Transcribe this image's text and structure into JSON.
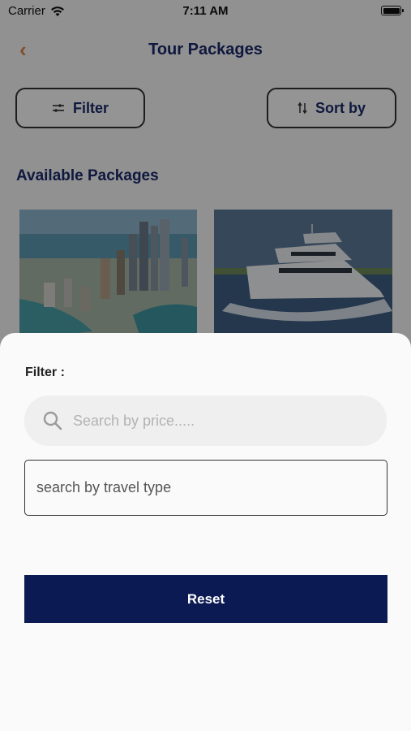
{
  "status": {
    "carrier": "Carrier",
    "time": "7:11 AM"
  },
  "nav": {
    "back_glyph": "‹",
    "title": "Tour Packages"
  },
  "toolbar": {
    "filter_label": "Filter",
    "sort_label": "Sort by"
  },
  "section": {
    "title": "Available Packages"
  },
  "packages": [
    {
      "image": "city-skyline-image"
    },
    {
      "image": "yacht-image"
    }
  ],
  "filter_sheet": {
    "label": "Filter :",
    "price_search_placeholder": "Search by price.....",
    "travel_type_placeholder": "search by travel type",
    "reset_label": "Reset"
  },
  "colors": {
    "brand_navy": "#0b1a52",
    "title_blue": "#1b2a6b",
    "back_orange": "#e0894a"
  }
}
